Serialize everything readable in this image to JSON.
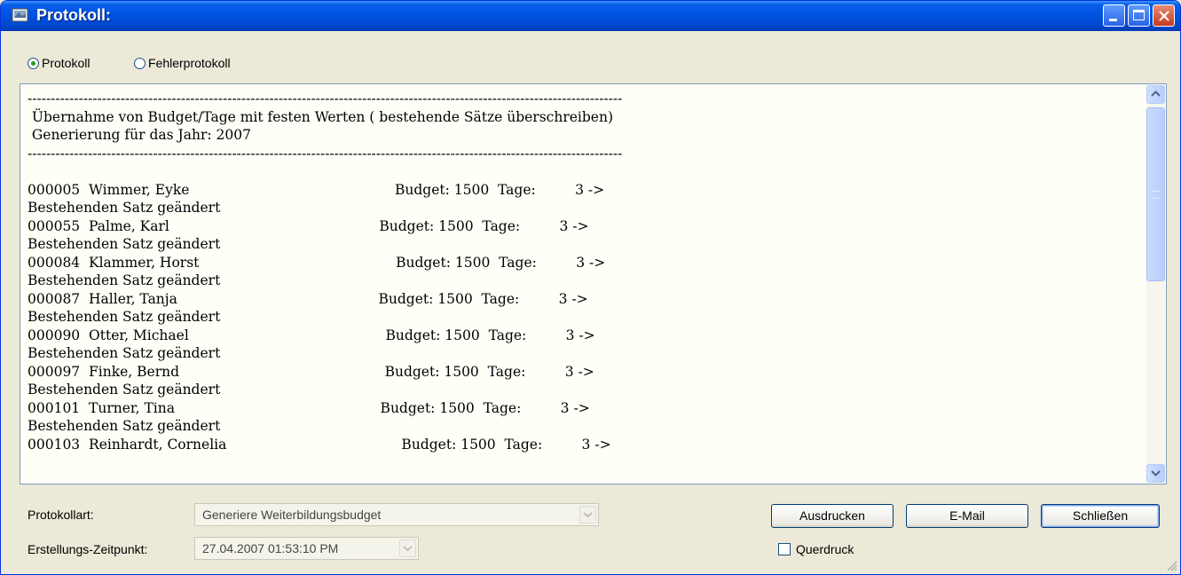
{
  "window": {
    "title": "Protokoll:"
  },
  "radios": {
    "protokoll": "Protokoll",
    "fehlerprotokoll": "Fehlerprotokoll",
    "selected": "Protokoll"
  },
  "log": {
    "lines": [
      "--------------------------------------------------------------------------------------------------------------------------------",
      " Übernahme von Budget/Tage mit festen Werten ( bestehende Sätze überschreiben)",
      " Generierung für das Jahr: 2007",
      "--------------------------------------------------------------------------------------------------------------------------------",
      "",
      "000005  Wimmer, Eyke                                               Budget: 1500  Tage:         3 ->",
      "Bestehenden Satz geändert",
      "000055  Palme, Karl                                                Budget: 1500  Tage:         3 ->",
      "Bestehenden Satz geändert",
      "000084  Klammer, Horst                                             Budget: 1500  Tage:         3 ->",
      "Bestehenden Satz geändert",
      "000087  Haller, Tanja                                              Budget: 1500  Tage:         3 ->",
      "Bestehenden Satz geändert",
      "000090  Otter, Michael                                             Budget: 1500  Tage:         3 ->",
      "Bestehenden Satz geändert",
      "000097  Finke, Bernd                                               Budget: 1500  Tage:         3 ->",
      "Bestehenden Satz geändert",
      "000101  Turner, Tina                                               Budget: 1500  Tage:         3 ->",
      "Bestehenden Satz geändert",
      "000103  Reinhardt, Cornelia                                        Budget: 1500  Tage:         3 ->"
    ]
  },
  "footer": {
    "protokollart_label": "Protokollart:",
    "protokollart_value": "Generiere Weiterbildungsbudget",
    "zeitpunkt_label": "Erstellungs-Zeitpunkt:",
    "zeitpunkt_value": "27.04.2007  01:53:10 PM",
    "print_label": "Ausdrucken",
    "email_label": "E-Mail",
    "close_label": "Schließen",
    "querdruck_label": "Querdruck"
  },
  "colors": {
    "title_bar": "#0054e3",
    "close_button": "#c5391c",
    "log_background": "#fffff7"
  }
}
